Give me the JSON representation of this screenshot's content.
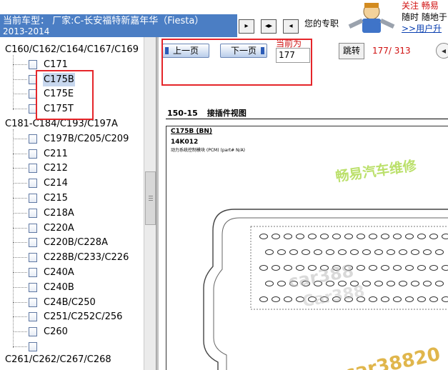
{
  "header": {
    "car_label": "当前车型：",
    "car_name": "厂家:C-长安福特新嘉年华（Fiesta）",
    "car_year": "2013-2014",
    "promo_text": "您的专职",
    "tagline_line1": "关注 畅易",
    "tagline_line2": "随时 随地于",
    "tagline_link": ">>用户升"
  },
  "tree": {
    "groups": [
      {
        "label": "C160/C162/C164/C167/C169",
        "items": [
          "C171",
          "C175B",
          "C175E",
          "C175T"
        ]
      },
      {
        "label": "C181-C184/C193/C197A",
        "items": [
          "C197B/C205/C209",
          "C211",
          "C212",
          "C214",
          "C215",
          "C218A",
          "C220A",
          "C220B/C228A",
          "C228B/C233/C226",
          "C240A",
          "C240B",
          "C24B/C250",
          "C251/C252C/256",
          "C260",
          ""
        ]
      }
    ],
    "selected_item": "C175B",
    "partial_bottom_label": "C261/C262/C267/C268"
  },
  "toolbar": {
    "prev_label": "上一页",
    "next_label": "下一页",
    "current_label": "当前为",
    "current_page": "177",
    "goto_label": "跳转",
    "page_count": "177/ 313"
  },
  "document": {
    "section_number": "150-15",
    "section_title": "接插件视图",
    "connector_name": "C175B (BN)",
    "part_number": "14K012",
    "part_description": "动力系统控制模块 (PCM) (part# N/A)",
    "watermark_text": "畅易汽车维修",
    "watermark_url": "car388",
    "watermark_url2": "Car388",
    "watermark_bottom": "car38820"
  },
  "colors": {
    "header_bar": "#4b7ec4",
    "selection": "#c7d7ee",
    "red_text": "#d01010",
    "highlight_box": "#e5252a",
    "watermark_green": "#9acd32"
  }
}
